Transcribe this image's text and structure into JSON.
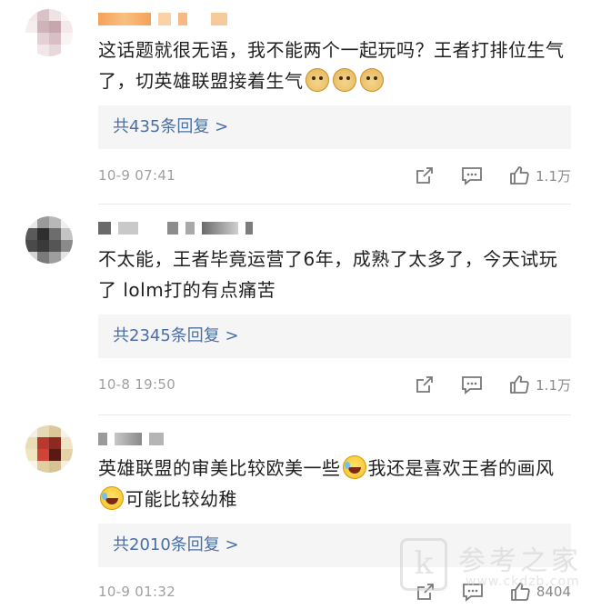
{
  "comments": [
    {
      "text_parts": [
        "这话题就很无语，我不能两个一起玩吗？王者打排位生气了，切英雄联盟接着生气"
      ],
      "emojis": [
        "doge-emoji",
        "doge-emoji",
        "doge-emoji"
      ],
      "replies_label": "共435条回复 >",
      "timestamp": "10-9 07:41",
      "likes": "1.1万"
    },
    {
      "text_parts": [
        "不太能，王者毕竟运营了6年，成熟了太多了，今天试玩了 lolm打的有点痛苦"
      ],
      "replies_label": "共2345条回复 >",
      "timestamp": "10-8 19:50",
      "likes": "1.1万"
    },
    {
      "text_parts": [
        "英雄联盟的审美比较欧美一些",
        "我还是喜欢王者的画风",
        "可能比较幼稚"
      ],
      "emojis": [
        "laugh-cry-emoji",
        "laugh-cry-emoji"
      ],
      "replies_label": "共2010条回复 >",
      "timestamp": "10-9 01:32",
      "likes": "8404"
    }
  ],
  "icons": {
    "share": "share-icon",
    "comment": "comment-icon",
    "like": "thumbs-up-icon"
  },
  "colors": {
    "link": "#4a6fa5",
    "muted": "#a0a0a0",
    "reply_bg": "#f5f5f5"
  },
  "watermark": {
    "logo_letter": "k",
    "title": "参考之家",
    "url": "www.ckdzb.com"
  }
}
